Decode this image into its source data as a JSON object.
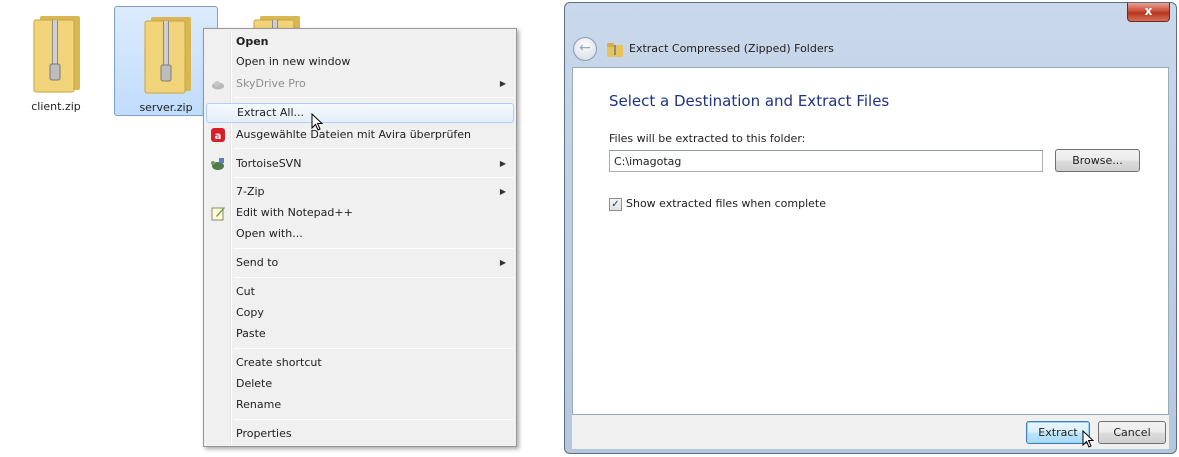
{
  "explorer": {
    "files": [
      {
        "name": "client.zip",
        "selected": false
      },
      {
        "name": "server.zip",
        "selected": true
      },
      {
        "name": "",
        "selected": false
      }
    ]
  },
  "context_menu": {
    "items": [
      {
        "label": "Open",
        "bold": true
      },
      {
        "label": "Open in new window"
      },
      {
        "label": "SkyDrive Pro",
        "disabled": true,
        "submenu": true,
        "icon": "cloud-icon"
      },
      {
        "label": "Extract All...",
        "highlighted": true
      },
      {
        "label": "Ausgewählte Dateien mit Avira überprüfen",
        "icon": "avira-icon"
      },
      {
        "label": "TortoiseSVN",
        "submenu": true,
        "icon": "tortoise-icon"
      },
      {
        "label": "7-Zip",
        "submenu": true
      },
      {
        "label": "Edit with Notepad++",
        "icon": "notepad-icon"
      },
      {
        "label": "Open with..."
      },
      {
        "label": "Send to",
        "submenu": true
      },
      {
        "label": "Cut"
      },
      {
        "label": "Copy"
      },
      {
        "label": "Paste"
      },
      {
        "label": "Create shortcut"
      },
      {
        "label": "Delete"
      },
      {
        "label": "Rename"
      },
      {
        "label": "Properties"
      }
    ]
  },
  "dialog": {
    "title": "Extract Compressed (Zipped) Folders",
    "close_label": "x",
    "heading": "Select a Destination and Extract Files",
    "folder_label": "Files will be extracted to this folder:",
    "path_value": "C:\\imagotag",
    "browse_label": "Browse...",
    "show_files_label": "Show extracted files when complete",
    "show_files_checked": true,
    "extract_label": "Extract",
    "cancel_label": "Cancel"
  },
  "colors": {
    "heading": "#1e3287",
    "selection": "#c1dcfc",
    "menu_bg": "#f0f0f0",
    "dialog_frame": "#b5c7dd"
  }
}
